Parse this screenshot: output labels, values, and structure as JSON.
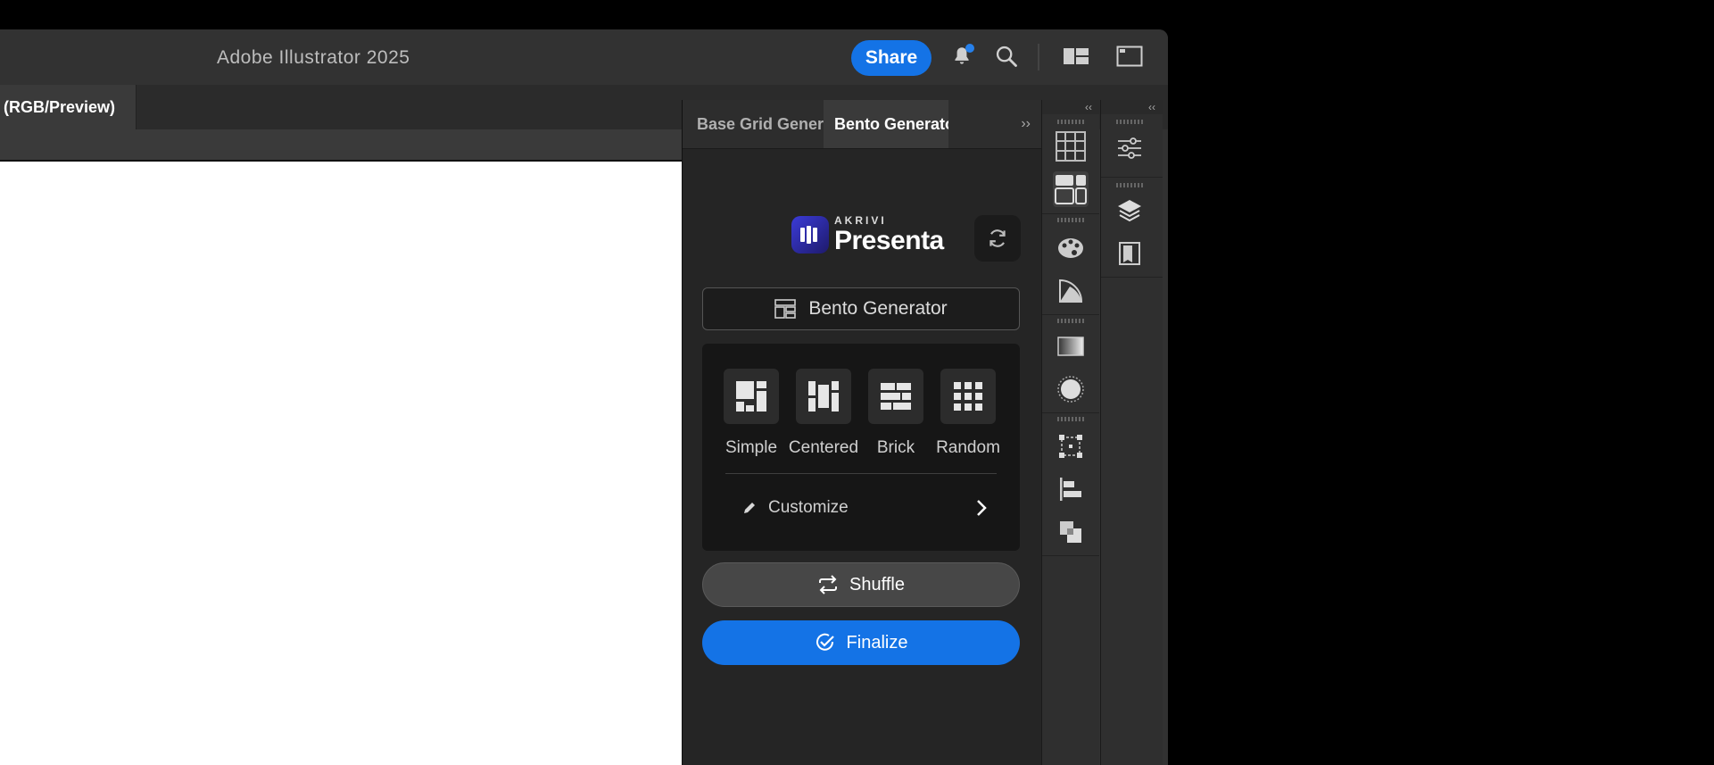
{
  "app": {
    "title": "Adobe Illustrator 2025"
  },
  "titlebar": {
    "share_label": "Share",
    "icons": [
      "bell-icon",
      "search-icon",
      "workspace-icon",
      "panel-toggle-icon"
    ]
  },
  "document": {
    "tab_label": "(RGB/Preview)"
  },
  "panel": {
    "tabs": [
      {
        "label": "Base Grid Generator"
      },
      {
        "label": "Bento Generator"
      }
    ],
    "collapse_label": "››",
    "logo": {
      "small": "AKRIVI",
      "big": "Presenta"
    },
    "generator_label": "Bento Generator",
    "layouts": [
      {
        "label": "Simple"
      },
      {
        "label": "Centered"
      },
      {
        "label": "Brick"
      },
      {
        "label": "Random"
      }
    ],
    "customize_label": "Customize",
    "shuffle_label": "Shuffle",
    "finalize_label": "Finalize"
  },
  "docks": {
    "collapse_label": "‹‹",
    "dock1_icons": [
      "grid-table-icon",
      "bento-layout-icon",
      "color-palette-icon",
      "color-guide-icon",
      "gradient-icon",
      "appearance-icon",
      "transform-icon",
      "align-icon",
      "pathfinder-icon"
    ],
    "dock2_icons": [
      "properties-icon",
      "layers-icon",
      "libraries-icon"
    ]
  },
  "colors": {
    "accent": "#1473e6",
    "panel_bg": "#252525",
    "app_bg": "#323232"
  }
}
